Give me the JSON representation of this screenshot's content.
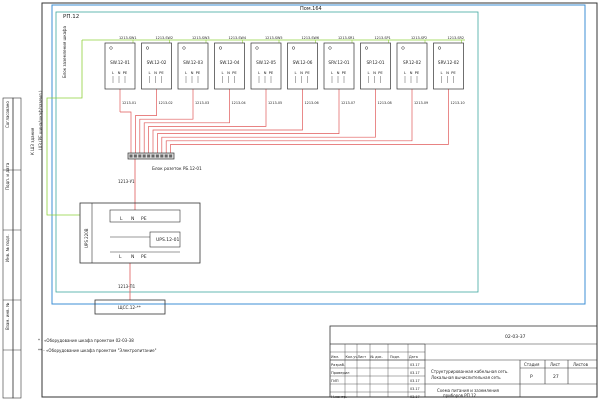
{
  "room_label": "Пом.164",
  "rack_label": "РП.12",
  "rack_ground_label": "Блок заземления шкафа",
  "switches": [
    {
      "name": "SW.12-01",
      "cable_in": "1213-SW1",
      "cable_out": "1213-01"
    },
    {
      "name": "SW.12-02",
      "cable_in": "1213-SW2",
      "cable_out": "1213-02"
    },
    {
      "name": "SW.12-03",
      "cable_in": "1213-SW3",
      "cable_out": "1213-03"
    },
    {
      "name": "SW.12-04",
      "cable_in": "1213-SW4",
      "cable_out": "1213-04"
    },
    {
      "name": "SW.12-05",
      "cable_in": "1213-SW5",
      "cable_out": "1213-05"
    },
    {
      "name": "SW.12-06",
      "cable_in": "1213-SW6",
      "cable_out": "1213-06"
    },
    {
      "name": "SRV.12-01",
      "cable_in": "1213-SR1",
      "cable_out": "1213-07"
    },
    {
      "name": "SP.12-01",
      "cable_in": "1213-SP1",
      "cable_out": "1213-08"
    },
    {
      "name": "SP.12-02",
      "cable_in": "1213-SP2",
      "cable_out": "1213-09"
    },
    {
      "name": "SRV.12-02",
      "cable_in": "1213-SR2",
      "cable_out": "1213-10"
    }
  ],
  "terminal_labels": [
    "L",
    "N",
    "PE"
  ],
  "outlet_block_label": "Блок розеток РБ.12-01",
  "ground_bus_label": "ШЗ (РЕ шина/шкаф/заземл.)",
  "ground_cable_label": "К ШЗ здания",
  "ups_cable_label": "1213-У1",
  "feed_cable_label": "1213-П1",
  "ups": {
    "name": "UPS.12-01",
    "note": "UPS 220В"
  },
  "feed_target": "ЩСС.12-**",
  "notes": [
    "* - «Оборудование шкафа проектом 02-03-38",
    "** - «Оборудование шкафа проектом \"Электропитание\""
  ],
  "side_labels": [
    "Подп. и дата",
    "Инв. № подл.",
    "Взам. инв. №",
    "Согласовано"
  ],
  "title_block": {
    "code": "02-03-37",
    "header_cells": [
      "Изм.",
      "Кол.уч.",
      "Лист",
      "№ док.",
      "Подп.",
      "Дата"
    ],
    "roles": [
      "Разраб.",
      "Проверил",
      "ГИП",
      "",
      "Н.контр."
    ],
    "dates": [
      "03.17",
      "03.17",
      "03.17",
      "03.17",
      "03.17"
    ],
    "project_text": [
      "Структурированная кабельная сеть.",
      "Локальная вычислительная сеть"
    ],
    "sheet_title": [
      "Схема питания и заземления",
      "приборов РП.12"
    ],
    "stage_label": "Стадия",
    "sheet_label": "Лист",
    "sheets_label": "Листов",
    "stage": "Р",
    "sheet": "27",
    "sheets": ""
  }
}
